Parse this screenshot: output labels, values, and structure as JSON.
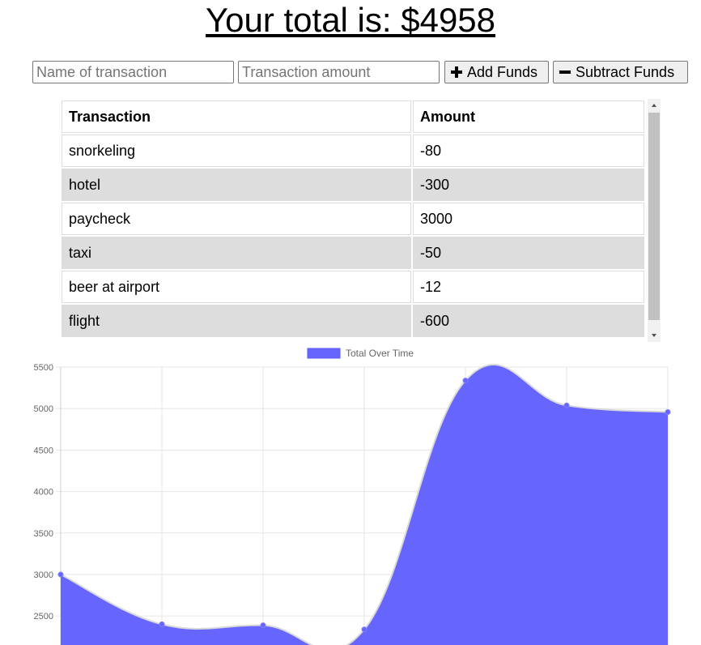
{
  "header": {
    "title": "Your total is: $4958"
  },
  "form": {
    "name_placeholder": "Name of transaction",
    "amount_placeholder": "Transaction amount",
    "add_label": "Add Funds",
    "subtract_label": "Subtract Funds"
  },
  "table": {
    "headers": [
      "Transaction",
      "Amount"
    ],
    "rows": [
      {
        "name": "snorkeling",
        "amount": "-80"
      },
      {
        "name": "hotel",
        "amount": "-300"
      },
      {
        "name": "paycheck",
        "amount": "3000"
      },
      {
        "name": "taxi",
        "amount": "-50"
      },
      {
        "name": "beer at airport",
        "amount": "-12"
      },
      {
        "name": "flight",
        "amount": "-600"
      }
    ]
  },
  "chart_data": {
    "type": "area",
    "series": [
      {
        "name": "Total Over Time",
        "values": [
          3000,
          2400,
          2388,
          2338,
          5338,
          5038,
          4958
        ]
      }
    ],
    "ylim": [
      2150,
      5500
    ],
    "yticks": [
      2500,
      3000,
      3500,
      4000,
      4500,
      5000,
      5500
    ],
    "xlabel": "",
    "ylabel": "",
    "legend": "top-center",
    "grid": true,
    "color": "#6666ff"
  }
}
